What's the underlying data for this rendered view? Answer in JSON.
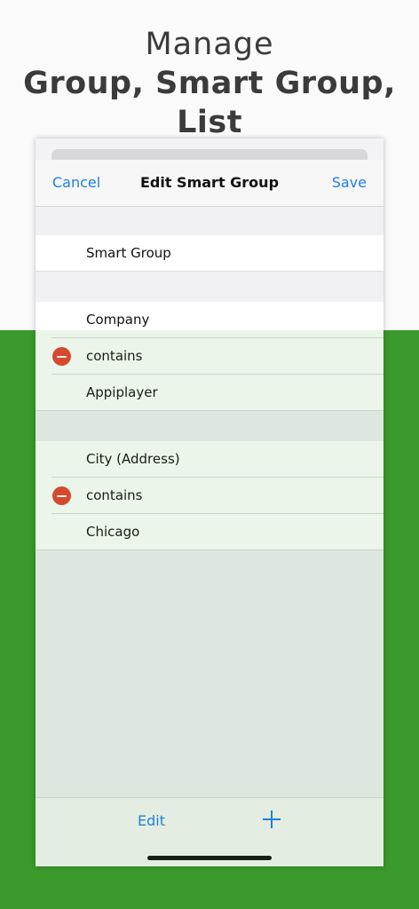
{
  "headline": {
    "line1": "Manage",
    "line2": "Group, Smart Group, List"
  },
  "navbar": {
    "cancel": "Cancel",
    "title": "Edit Smart Group",
    "save": "Save"
  },
  "name_section": {
    "name_value": "Smart Group"
  },
  "conditions": [
    {
      "field": "Company",
      "operator": "contains",
      "value": "Appiplayer"
    },
    {
      "field": "City (Address)",
      "operator": "contains",
      "value": "Chicago"
    }
  ],
  "toolbar": {
    "edit": "Edit",
    "add_icon": "plus-icon"
  },
  "colors": {
    "accent": "#1f7ee8",
    "delete": "#e8402f",
    "brand_green": "#3a9a2b"
  }
}
